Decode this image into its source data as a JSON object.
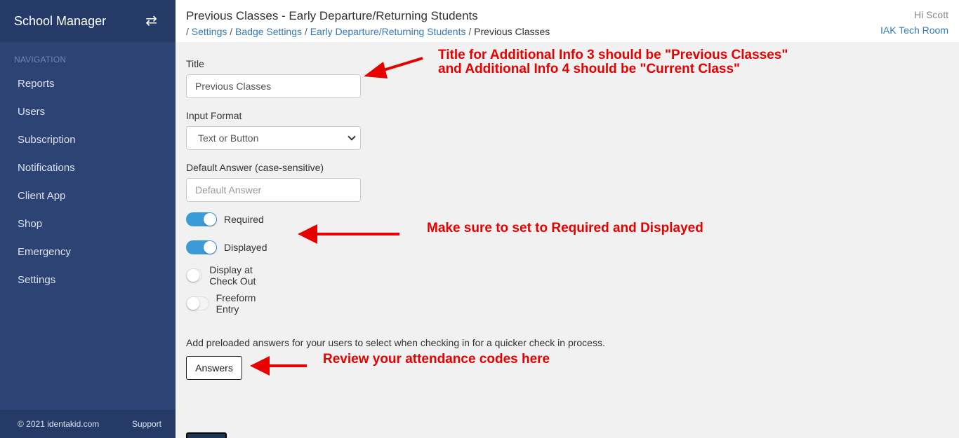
{
  "sidebar": {
    "brand": "School Manager",
    "toggle_icon": "⇄",
    "nav_heading": "NAVIGATION",
    "items": [
      {
        "label": "Reports"
      },
      {
        "label": "Users"
      },
      {
        "label": "Subscription"
      },
      {
        "label": "Notifications"
      },
      {
        "label": "Client App"
      },
      {
        "label": "Shop"
      },
      {
        "label": "Emergency"
      },
      {
        "label": "Settings"
      }
    ],
    "footer": {
      "copyright": "© 2021 identakid.com",
      "support": "Support"
    }
  },
  "header": {
    "title": "Previous Classes - Early Departure/Returning Students",
    "breadcrumb": {
      "settings": "Settings",
      "badge_settings": "Badge Settings",
      "early_departure": "Early Departure/Returning Students",
      "current": "Previous Classes"
    },
    "greeting": "Hi Scott",
    "room": "IAK Tech Room"
  },
  "form": {
    "title_label": "Title",
    "title_value": "Previous Classes",
    "input_format_label": "Input Format",
    "input_format_value": "Text or Button",
    "default_answer_label": "Default Answer (case-sensitive)",
    "default_answer_placeholder": "Default Answer",
    "toggles": [
      {
        "label": "Required",
        "on": true
      },
      {
        "label": "Displayed",
        "on": true
      },
      {
        "label": "Display at Check Out",
        "on": false
      },
      {
        "label": "Freeform Entry",
        "on": false
      }
    ],
    "help_text": "Add preloaded answers for your users to select when checking in for a quicker check in process.",
    "answers_button": "Answers"
  },
  "annotations": {
    "title_note": "Title for Additional Info 3 should be \"Previous Classes\" and Additional Info 4 should be \"Current Class\"",
    "toggles_note": "Make sure to set to Required and Displayed",
    "answers_note": "Review your attendance codes here",
    "color": "#e60000"
  }
}
